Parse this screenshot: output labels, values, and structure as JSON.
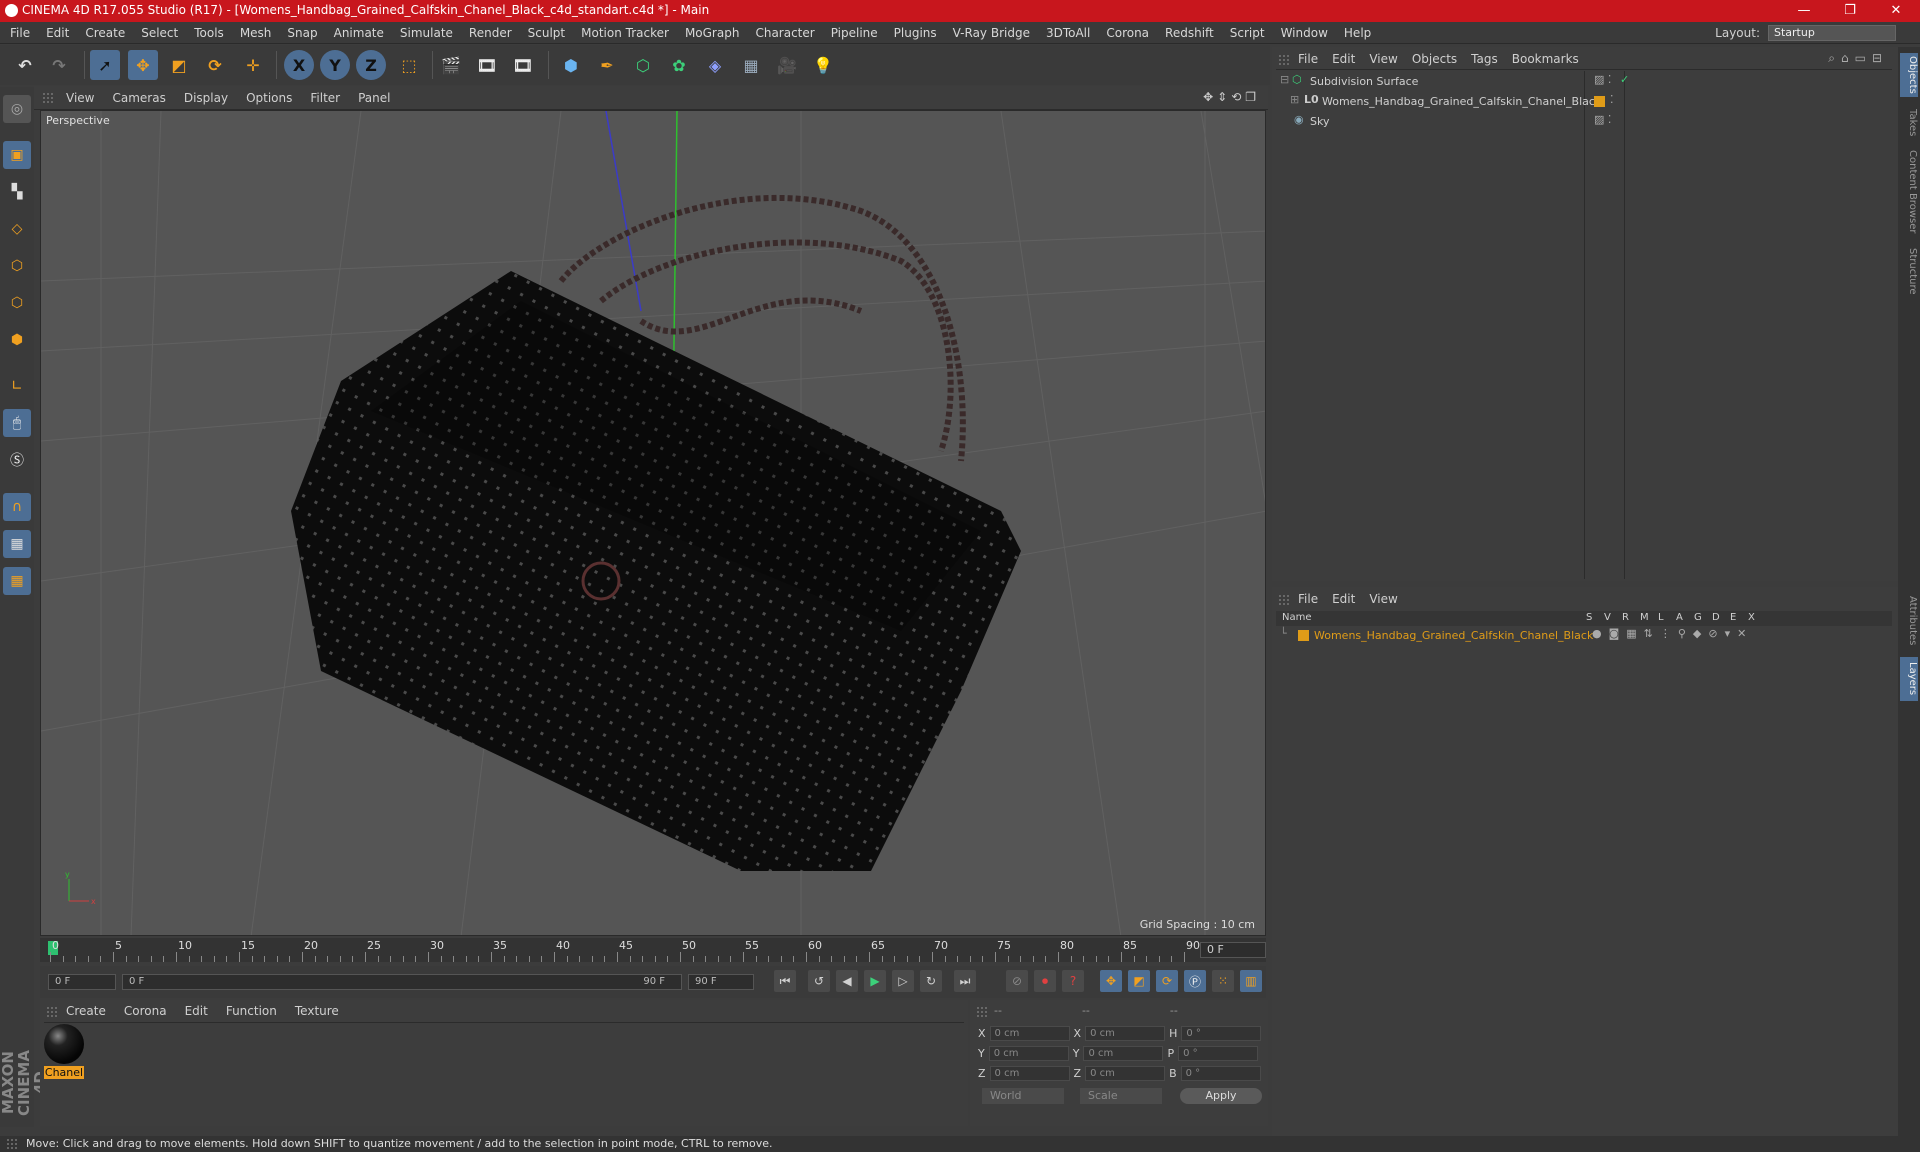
{
  "window": {
    "title": "CINEMA 4D R17.055 Studio (R17) - [Womens_Handbag_Grained_Calfskin_Chanel_Black_c4d_standart.c4d *] - Main"
  },
  "menu": [
    "File",
    "Edit",
    "Create",
    "Select",
    "Tools",
    "Mesh",
    "Snap",
    "Animate",
    "Simulate",
    "Render",
    "Sculpt",
    "Motion Tracker",
    "MoGraph",
    "Character",
    "Pipeline",
    "Plugins",
    "V-Ray Bridge",
    "3DToAll",
    "Corona",
    "Redshift",
    "Script",
    "Window",
    "Help"
  ],
  "layout": {
    "label": "Layout:",
    "value": "Startup"
  },
  "toolbar": {
    "x": "X",
    "y": "Y",
    "z": "Z"
  },
  "viewport": {
    "menu": [
      "View",
      "Cameras",
      "Display",
      "Options",
      "Filter",
      "Panel"
    ],
    "label": "Perspective",
    "grid_spacing": "Grid Spacing : 10 cm"
  },
  "timeline": {
    "ticks": [
      "0",
      "5",
      "10",
      "15",
      "20",
      "25",
      "30",
      "35",
      "40",
      "45",
      "50",
      "55",
      "60",
      "65",
      "70",
      "75",
      "80",
      "85",
      "90"
    ],
    "current_frame": "0 F"
  },
  "playback": {
    "start": "0 F",
    "range_start": "0 F",
    "range_end": "90 F",
    "end": "90 F"
  },
  "material_panel": {
    "menu": [
      "Create",
      "Corona",
      "Edit",
      "Function",
      "Texture"
    ],
    "materials": [
      {
        "name": "Chanel"
      }
    ]
  },
  "coords": {
    "header": [
      "--",
      "--",
      "--"
    ],
    "rows": [
      {
        "a": "X",
        "av": "0 cm",
        "b": "X",
        "bv": "0 cm",
        "c": "H",
        "cv": "0 °"
      },
      {
        "a": "Y",
        "av": "0 cm",
        "b": "Y",
        "bv": "0 cm",
        "c": "P",
        "cv": "0 °"
      },
      {
        "a": "Z",
        "av": "0 cm",
        "b": "Z",
        "bv": "0 cm",
        "c": "B",
        "cv": "0 °"
      }
    ],
    "mode": "World",
    "transform": "Scale",
    "apply": "Apply"
  },
  "object_manager": {
    "menu": [
      "File",
      "Edit",
      "View",
      "Objects",
      "Tags",
      "Bookmarks"
    ],
    "objects": [
      {
        "name": "Subdivision Surface"
      },
      {
        "name": "Womens_Handbag_Grained_Calfskin_Chanel_Black"
      },
      {
        "name": "Sky"
      }
    ]
  },
  "layer_manager": {
    "menu": [
      "File",
      "Edit",
      "View"
    ],
    "columns": [
      "Name",
      "S",
      "V",
      "R",
      "M",
      "L",
      "A",
      "G",
      "D",
      "E",
      "X"
    ],
    "layers": [
      {
        "name": "Womens_Handbag_Grained_Calfskin_Chanel_Black",
        "color": "#e09c18"
      }
    ]
  },
  "right_tabs": [
    "Objects",
    "Takes",
    "Content Browser",
    "Structure",
    "Attributes",
    "Layers"
  ],
  "branding": "MAXON CINEMA 4D",
  "status": "Move: Click and drag to move elements. Hold down SHIFT to quantize movement / add to the selection in point mode, CTRL to remove."
}
